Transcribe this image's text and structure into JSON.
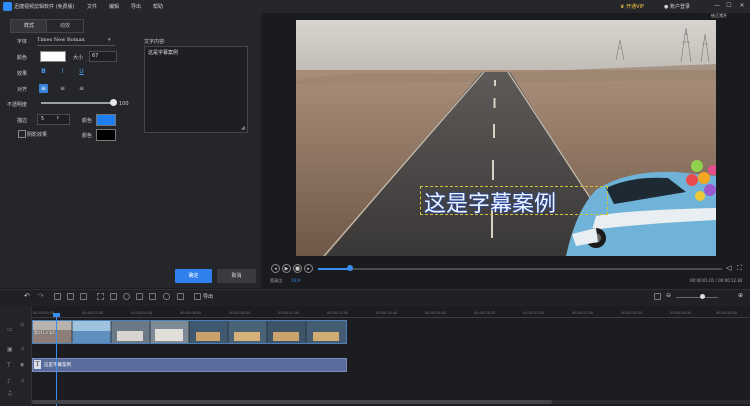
{
  "app": {
    "title": "迅捷视频剪辑软件 (免费版)",
    "menu": [
      "文件",
      "编辑",
      "导出",
      "帮助"
    ],
    "vip_label": "开通VIP",
    "account_label": "账户登录",
    "window_controls": [
      "—",
      "☐",
      "✕"
    ]
  },
  "panel": {
    "tabs": [
      "样式",
      "动效"
    ],
    "font_label": "字体",
    "font_value": "Times New Roman",
    "color_label": "颜色",
    "size_label": "大小",
    "size_value": "67",
    "format_label": "效果",
    "format_buttons": [
      "B",
      "I",
      "U"
    ],
    "align_label": "对齐",
    "align_buttons": [
      "≡",
      "≡",
      "≡"
    ],
    "opacity_label": "不透明度",
    "opacity_value": "100",
    "stroke_label": "描边",
    "stroke_value": "5",
    "stroke_color_label": "颜色",
    "shadow_label": "阴影效果",
    "shadow_color_label": "颜色",
    "text_content_label": "文字内容:",
    "text_content_value": "这是字幕案例",
    "ok_label": "确定",
    "cancel_label": "取消"
  },
  "preview": {
    "badge": "给正常开",
    "subtitle": "这是字幕案例",
    "aspect_label": "宽高比:",
    "aspect_value": "16:9",
    "time": "00:00:01.01 / 00:00:12.82",
    "progress": 0.08
  },
  "toolbar": {
    "export_label": "导出"
  },
  "timeline": {
    "ruler": [
      "00:00:00.00",
      "00:00:02.00",
      "00:00:04.00",
      "00:00:06.00",
      "00:00:08.00",
      "00:00:10.00",
      "00:00:12.00",
      "00:00:14.00",
      "00:00:16.00",
      "00:00:18.00",
      "00:00:20.00",
      "00:00:22.00",
      "00:00:24.00",
      "00:00:26.00",
      "00:00:28.00"
    ],
    "video_clip_label": "素材1.mp4",
    "subtitle_clip_label": "这是字幕案例"
  },
  "colors": {
    "accent": "#2f80ed",
    "stroke_color": "#1f7ff0",
    "shadow_color": "#000000",
    "text_color": "#ffffff"
  }
}
